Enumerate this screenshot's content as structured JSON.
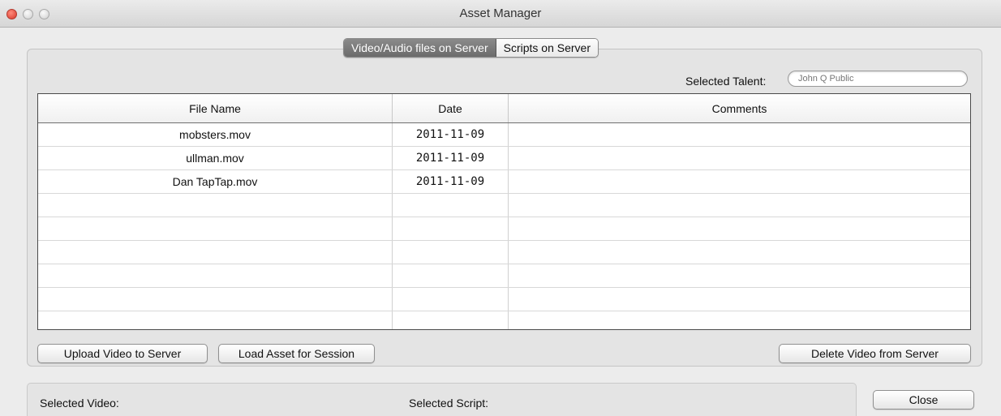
{
  "window": {
    "title": "Asset Manager"
  },
  "tabs": [
    {
      "label": "Video/Audio files on Server",
      "active": true
    },
    {
      "label": "Scripts on Server",
      "active": false
    }
  ],
  "talent": {
    "label": "Selected Talent:",
    "placeholder": "John Q Public",
    "value": ""
  },
  "table": {
    "columns": [
      "File Name",
      "Date",
      "Comments"
    ],
    "rows": [
      {
        "file_name": "mobsters.mov",
        "date": "2011-11-09",
        "comments": ""
      },
      {
        "file_name": "ullman.mov",
        "date": "2011-11-09",
        "comments": ""
      },
      {
        "file_name": "Dan TapTap.mov",
        "date": "2011-11-09",
        "comments": ""
      },
      {
        "file_name": "",
        "date": "",
        "comments": ""
      },
      {
        "file_name": "",
        "date": "",
        "comments": ""
      },
      {
        "file_name": "",
        "date": "",
        "comments": ""
      },
      {
        "file_name": "",
        "date": "",
        "comments": ""
      },
      {
        "file_name": "",
        "date": "",
        "comments": ""
      },
      {
        "file_name": "",
        "date": "",
        "comments": ""
      }
    ]
  },
  "buttons": {
    "upload": "Upload Video to Server",
    "load": "Load Asset for Session",
    "delete": "Delete Video from Server",
    "close": "Close"
  },
  "status": {
    "video_label": "Selected Video:",
    "video_value": "",
    "script_label": "Selected Script:",
    "script_value": ""
  },
  "colors": {
    "active_tab": "#7a7a7a",
    "window_bg": "#ececec",
    "close_button": "#d8382a"
  }
}
